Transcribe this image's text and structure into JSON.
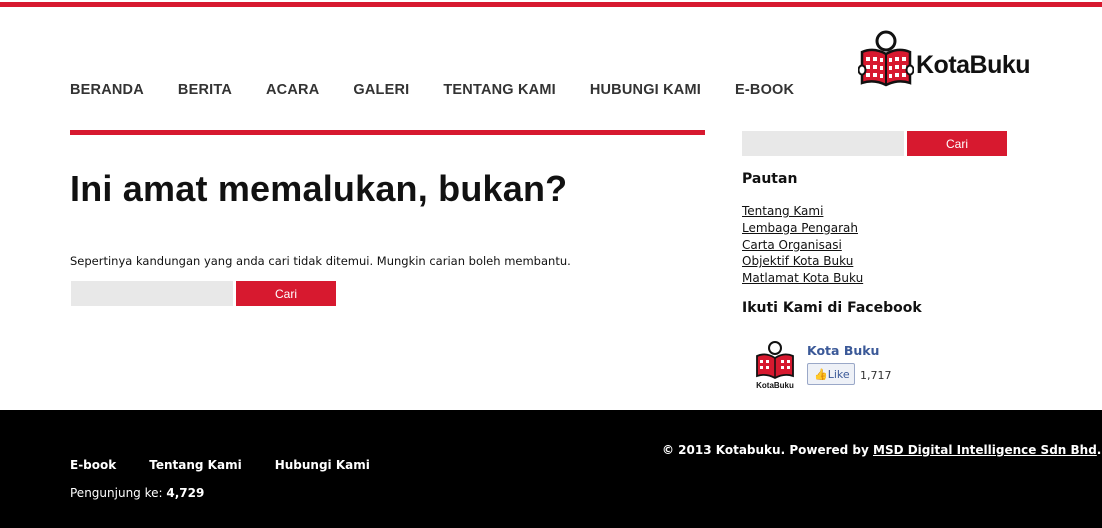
{
  "nav": [
    "BERANDA",
    "BERITA",
    "ACARA",
    "GALERI",
    "TENTANG KAMI",
    "HUBUNGI KAMI",
    "E-BOOK"
  ],
  "logo": {
    "text": "KotaBuku"
  },
  "main": {
    "heading": "Ini amat memalukan, bukan?",
    "message": "Sepertinya kandungan yang anda cari tidak ditemui. Mungkin carian boleh membantu.",
    "search_button": "Cari"
  },
  "sidebar": {
    "search_button": "Cari",
    "links_title": "Pautan",
    "links": [
      "Tentang Kami",
      "Lembaga Pengarah",
      "Carta Organisasi",
      "Objektif Kota Buku",
      "Matlamat Kota Buku"
    ],
    "facebook_title": "Ikuti Kami di Facebook",
    "facebook": {
      "page_name": "Kota Buku",
      "logo_text": "KotaBuku",
      "like_label": "Like",
      "like_count": "1,717"
    }
  },
  "footer": {
    "copyright": "© 2013 Kotabuku. Powered by ",
    "company_link": "MSD Digital Intelligence Sdn Bhd",
    "copyright_end": ".",
    "links": [
      "E-book",
      "Tentang Kami",
      "Hubungi Kami"
    ],
    "visitor_label": "Pengunjung ke: ",
    "visitor_count": "4,729"
  },
  "colors": {
    "accent": "#d7192f",
    "footer_bg": "#000000",
    "facebook_blue": "#3b5998"
  }
}
